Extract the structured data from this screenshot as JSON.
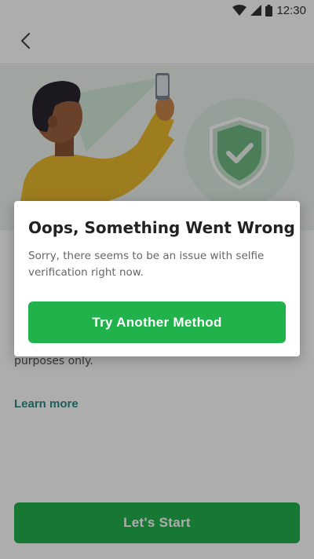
{
  "status_bar": {
    "time": "12:30",
    "icons": [
      "wifi-icon",
      "cell-signal-icon",
      "battery-icon"
    ]
  },
  "app_bar": {
    "back_icon": "chevron-left-icon"
  },
  "hero": {
    "illustration": "person-taking-selfie",
    "badge_icon": "shield-check-icon"
  },
  "page": {
    "partial_text": "purposes only.",
    "learn_more_label": "Learn more",
    "start_button_label": "Let's Start"
  },
  "dialog": {
    "title": "Oops, Something Went Wrong",
    "body": "Sorry, there seems to be an issue with selfie verification right now.",
    "button_label": "Try Another Method"
  },
  "colors": {
    "accent_green": "#22b24c",
    "link_teal": "#2e8a86",
    "hero_background": "#eef3ef",
    "scrim": "rgba(0,0,0,0.32)"
  }
}
